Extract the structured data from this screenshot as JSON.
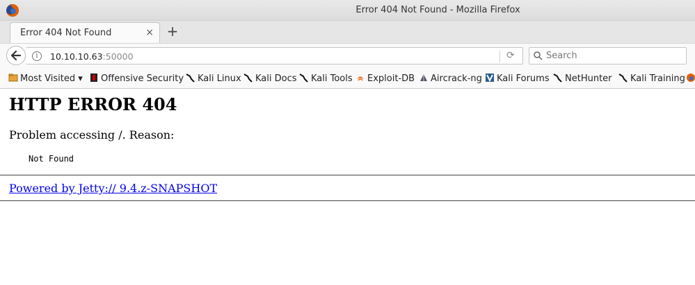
{
  "window": {
    "title": "Error 404 Not Found - Mozilla Firefox"
  },
  "tab": {
    "title": "Error 404 Not Found",
    "close": "×",
    "new_tab": "+"
  },
  "url": {
    "host": "10.10.10.63",
    "port": ":50000"
  },
  "search": {
    "placeholder": "Search"
  },
  "bookmarks": [
    {
      "label": "Most Visited",
      "icon": "folder-icon"
    },
    {
      "label": "Offensive Security",
      "icon": "offsec-icon"
    },
    {
      "label": "Kali Linux",
      "icon": "kali-dragon-icon"
    },
    {
      "label": "Kali Docs",
      "icon": "kali-dragon-icon"
    },
    {
      "label": "Kali Tools",
      "icon": "kali-dragon-icon"
    },
    {
      "label": "Exploit-DB",
      "icon": "exploitdb-icon"
    },
    {
      "label": "Aircrack-ng",
      "icon": "aircrack-icon"
    },
    {
      "label": "Kali Forums",
      "icon": "kali-forums-icon"
    },
    {
      "label": "NetHunter",
      "icon": "kali-dragon-icon"
    },
    {
      "label": "Kali Training",
      "icon": "kali-dragon-icon"
    }
  ],
  "page": {
    "heading": "HTTP ERROR 404",
    "reason": "Problem accessing /. Reason:",
    "message": "Not Found",
    "powered_by": "Powered by Jetty:// 9.4.z-SNAPSHOT"
  },
  "colors": {
    "link": "#0000ee",
    "firefox": "#e66000"
  }
}
